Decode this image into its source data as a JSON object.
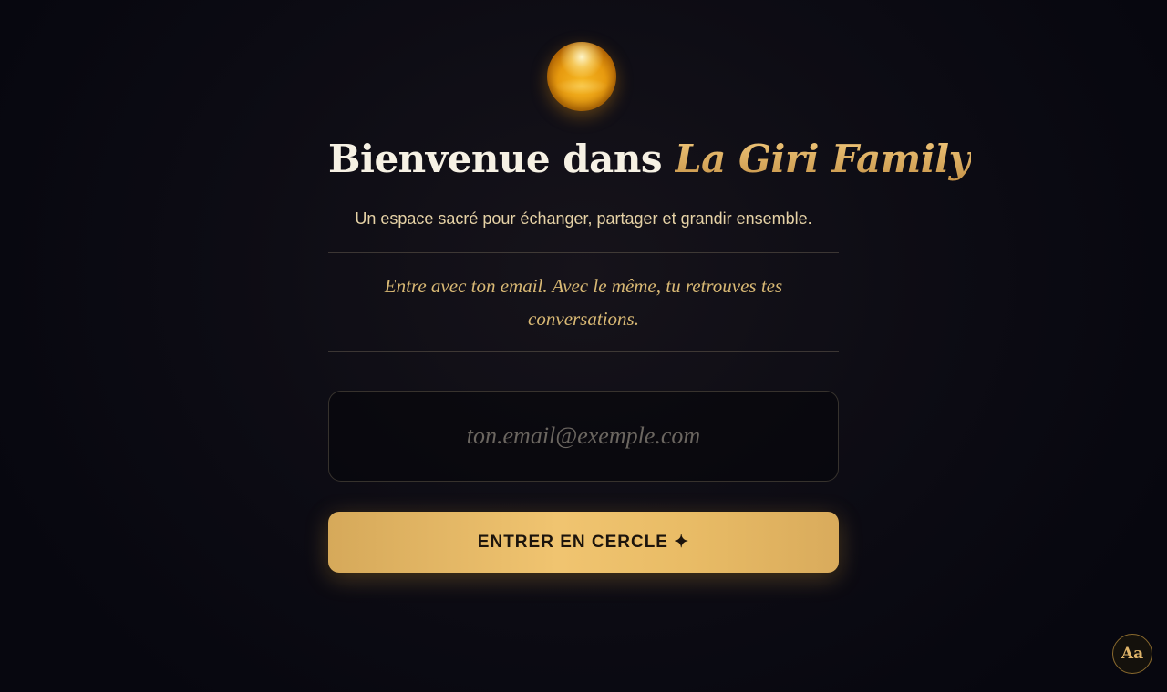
{
  "header": {
    "orb_icon": "golden-orb-icon",
    "title_prefix": "Bienvenue dans ",
    "title_brand": "La Giri Family",
    "subtitle": "Un espace sacré pour échanger, partager et grandir ensemble."
  },
  "form": {
    "hint": "Entre avec ton email. Avec le même, tu retrouves tes conversations.",
    "email_value": "",
    "email_placeholder": "ton.email@exemple.com",
    "submit_label": "ENTRER EN CERCLE ✦"
  },
  "corner": {
    "font_toggle_label": "Aa"
  },
  "colors": {
    "accent_gold": "#d9a85a",
    "button_gold": "#f0c470",
    "background": "#0d0c14"
  }
}
